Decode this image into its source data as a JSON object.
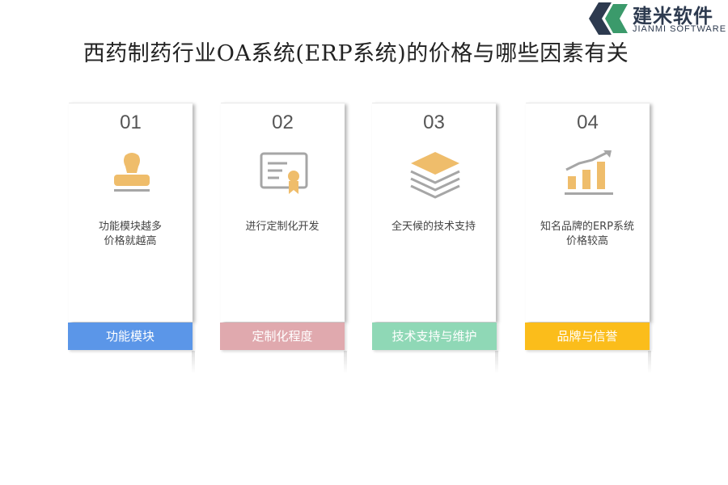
{
  "title": "西药制药行业OA系统(ERP系统)的价格与哪些因素有关",
  "logo": {
    "name_cn": "建米软件",
    "name_en": "JIANMI SOFTWARE"
  },
  "colors": {
    "icon": "#efbd6b",
    "icon_outline": "#a6a6a6",
    "bar1": "#5b96e8",
    "bar2": "#e0a9ae",
    "bar3": "#8fd8b6",
    "bar4": "#fbbd1b"
  },
  "cards": [
    {
      "num": "01",
      "icon": "stamp-icon",
      "desc": "功能模块越多\n价格就越高",
      "label": "功能模块"
    },
    {
      "num": "02",
      "icon": "certificate-icon",
      "desc": "进行定制化开发",
      "label": "定制化程度"
    },
    {
      "num": "03",
      "icon": "layers-icon",
      "desc": "全天候的技术支持",
      "label": "技术支持与维护"
    },
    {
      "num": "04",
      "icon": "growth-chart-icon",
      "desc": "知名品牌的ERP系统\n价格较高",
      "label": "品牌与信誉"
    }
  ]
}
